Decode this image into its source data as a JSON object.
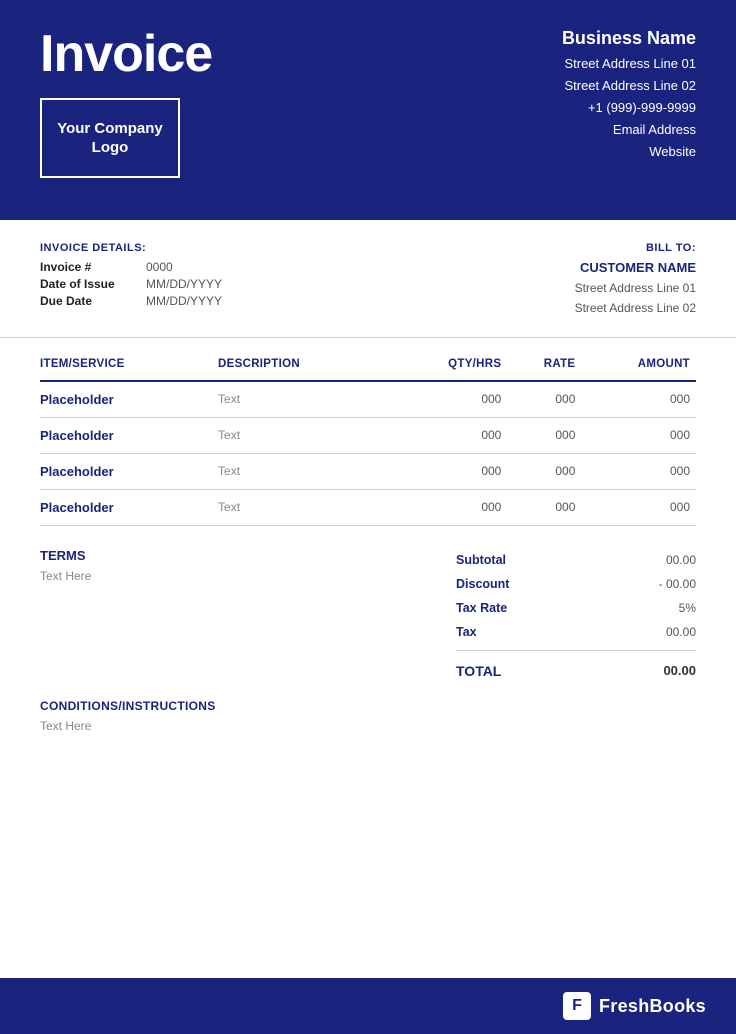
{
  "header": {
    "title": "Invoice",
    "logo_text": "Your Company Logo",
    "business": {
      "name": "Business Name",
      "address1": "Street Address Line 01",
      "address2": "Street Address Line 02",
      "phone": "+1 (999)-999-9999",
      "email": "Email Address",
      "website": "Website"
    }
  },
  "invoice_details": {
    "section_label": "INVOICE DETAILS:",
    "rows": [
      {
        "label": "Invoice #",
        "value": "0000"
      },
      {
        "label": "Date of Issue",
        "value": "MM/DD/YYYY"
      },
      {
        "label": "Due Date",
        "value": "MM/DD/YYYY"
      }
    ]
  },
  "bill_to": {
    "label": "BILL TO:",
    "customer_name": "CUSTOMER NAME",
    "address1": "Street Address Line 01",
    "address2": "Street Address Line 02"
  },
  "table": {
    "columns": [
      "ITEM/SERVICE",
      "DESCRIPTION",
      "QTY/HRS",
      "RATE",
      "AMOUNT"
    ],
    "rows": [
      {
        "item": "Placeholder",
        "desc": "Text",
        "qty": "000",
        "rate": "000",
        "amount": "000"
      },
      {
        "item": "Placeholder",
        "desc": "Text",
        "qty": "000",
        "rate": "000",
        "amount": "000"
      },
      {
        "item": "Placeholder",
        "desc": "Text",
        "qty": "000",
        "rate": "000",
        "amount": "000"
      },
      {
        "item": "Placeholder",
        "desc": "Text",
        "qty": "000",
        "rate": "000",
        "amount": "000"
      }
    ]
  },
  "terms": {
    "label": "TERMS",
    "text": "Text Here"
  },
  "totals": {
    "subtotal_label": "Subtotal",
    "subtotal_value": "00.00",
    "discount_label": "Discount",
    "discount_value": "- 00.00",
    "taxrate_label": "Tax Rate",
    "taxrate_value": "5%",
    "tax_label": "Tax",
    "tax_value": "00.00",
    "total_label": "TOTAL",
    "total_value": "00.00"
  },
  "conditions": {
    "label": "CONDITIONS/INSTRUCTIONS",
    "text": "Text Here"
  },
  "footer": {
    "brand_icon": "F",
    "brand_name": "FreshBooks"
  }
}
